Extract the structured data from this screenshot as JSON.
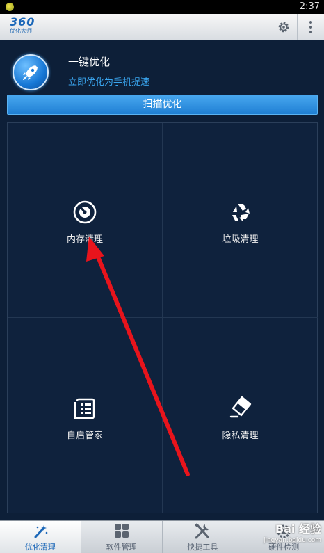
{
  "status_bar": {
    "time": "2:37"
  },
  "app": {
    "logo_number": "360",
    "logo_subtitle": "优化大师"
  },
  "hero": {
    "title": "一键优化",
    "subtitle": "立即优化为手机提速"
  },
  "scan_button": {
    "label": "扫描优化"
  },
  "tiles": [
    {
      "label": "内存清理",
      "icon": "memory-gauge-icon"
    },
    {
      "label": "垃圾清理",
      "icon": "recycle-icon"
    },
    {
      "label": "自启管家",
      "icon": "startup-list-icon"
    },
    {
      "label": "隐私清理",
      "icon": "eraser-icon"
    }
  ],
  "tabs": [
    {
      "label": "优化清理",
      "icon": "magic-wand-icon",
      "active": true
    },
    {
      "label": "软件管理",
      "icon": "app-grid-icon",
      "active": false
    },
    {
      "label": "快捷工具",
      "icon": "tools-icon",
      "active": false
    },
    {
      "label": "硬件检测",
      "icon": "hardware-gear-icon",
      "active": false
    }
  ],
  "watermark": {
    "mark": "Bai 经验",
    "url": "jingyan.baidu.com"
  },
  "colors": {
    "background": "#0d1f38",
    "accent": "#1f7fd3",
    "subtitle": "#3aa6f0",
    "annotation_arrow": "#e8141c"
  }
}
